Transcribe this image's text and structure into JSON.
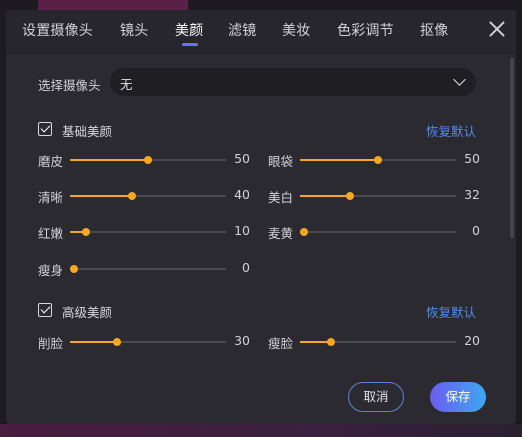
{
  "tabs": [
    {
      "label": "设置摄像头"
    },
    {
      "label": "镜头"
    },
    {
      "label": "美颜"
    },
    {
      "label": "滤镜"
    },
    {
      "label": "美妆"
    },
    {
      "label": "色彩调节"
    },
    {
      "label": "抠像"
    }
  ],
  "active_tab": "美颜",
  "camera": {
    "label": "选择摄像头",
    "value": "无"
  },
  "basic": {
    "title": "基础美颜",
    "checked": true,
    "reset": "恢复默认",
    "params": [
      {
        "label": "磨皮",
        "value": 50,
        "max": 100
      },
      {
        "label": "眼袋",
        "value": 50,
        "max": 100
      },
      {
        "label": "清晰",
        "value": 40,
        "max": 100
      },
      {
        "label": "美白",
        "value": 32,
        "max": 100
      },
      {
        "label": "红嫩",
        "value": 10,
        "max": 100
      },
      {
        "label": "麦黄",
        "value": 0,
        "max": 100
      },
      {
        "label": "瘦身",
        "value": 0,
        "max": 100
      }
    ]
  },
  "advanced": {
    "title": "高级美颜",
    "checked": true,
    "reset": "恢复默认",
    "params": [
      {
        "label": "削脸",
        "value": 30,
        "max": 100
      },
      {
        "label": "瘦脸",
        "value": 20,
        "max": 100
      }
    ]
  },
  "buttons": {
    "cancel": "取消",
    "save": "保存"
  },
  "colors": {
    "accent": "#f5a623",
    "link": "#4e8df5",
    "tab_indicator": "#6a72ff"
  },
  "icons": {
    "close": "close-icon",
    "dropdown": "chevron-down-icon",
    "check": "check-icon"
  }
}
